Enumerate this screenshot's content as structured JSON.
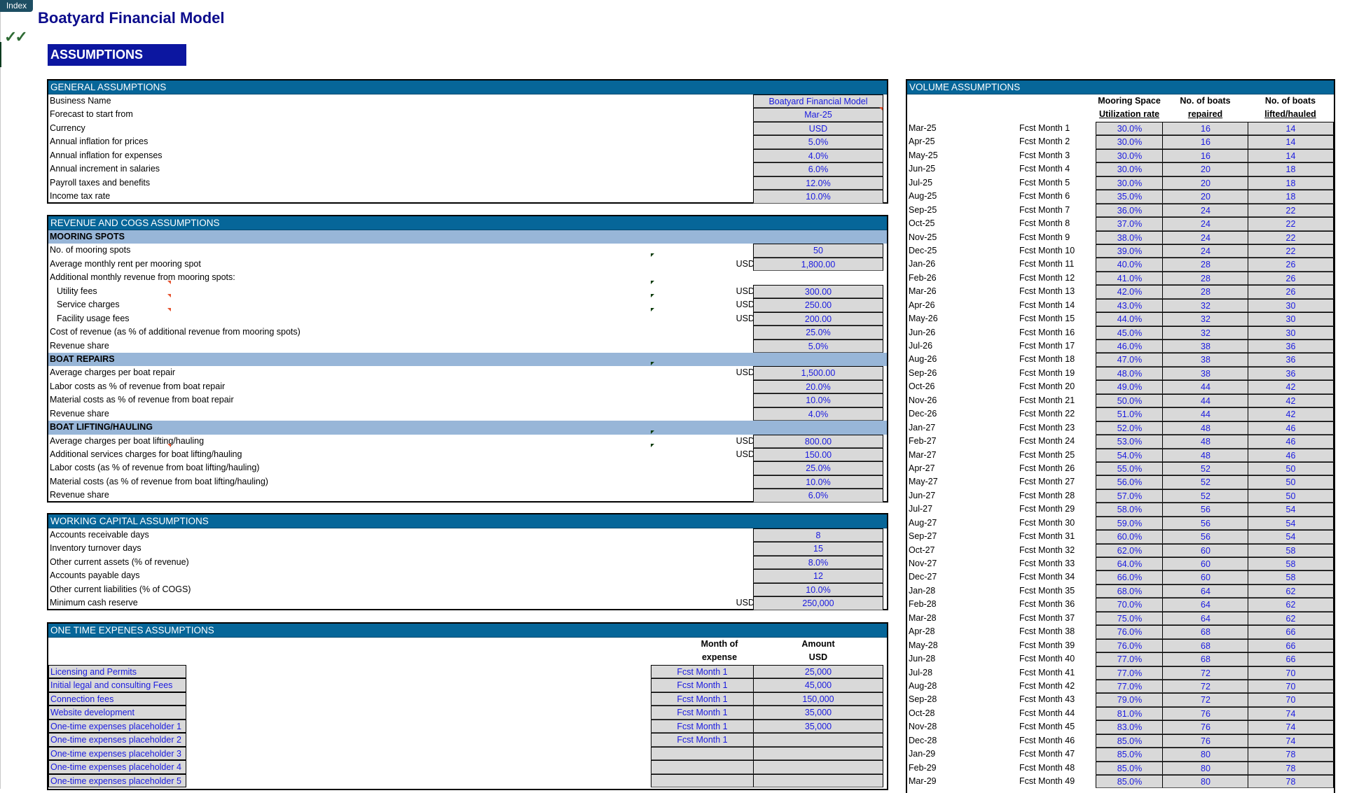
{
  "app": {
    "index_button": "Index",
    "title": "Boatyard Financial Model",
    "check_icon": "✓✓",
    "section_banner": "ASSUMPTIONS"
  },
  "colors": {
    "section_header": "#066699",
    "subsection_header": "#98b6d8",
    "input_text": "#1a1adf",
    "input_fill": "#d9d9d9",
    "title": "#0c0c8c",
    "banner": "#0c16a0"
  },
  "general": {
    "title": "GENERAL ASSUMPTIONS",
    "rows": [
      {
        "label": "Business Name",
        "value": "Boatyard Financial Model"
      },
      {
        "label": "Forecast to start from",
        "value": "Mar-25"
      },
      {
        "label": "Currency",
        "value": "USD"
      },
      {
        "label": "Annual inflation for prices",
        "value": "5.0%"
      },
      {
        "label": "Annual inflation for expenses",
        "value": "4.0%"
      },
      {
        "label": "Annual increment in salaries",
        "value": "6.0%"
      },
      {
        "label": "Payroll taxes and benefits",
        "value": "12.0%"
      },
      {
        "label": "Income tax rate",
        "value": "10.0%"
      }
    ]
  },
  "revenue": {
    "title": "REVENUE AND COGS ASSUMPTIONS",
    "mooring": {
      "title": "MOORING SPOTS",
      "rows": [
        {
          "label": "No. of mooring spots",
          "currency": "",
          "value": "50"
        },
        {
          "label": "Average monthly rent per mooring spot",
          "currency": "USD",
          "value": "1,800.00"
        },
        {
          "label": "Additional monthly revenue from mooring spots:",
          "currency": "",
          "value": null
        },
        {
          "label": "Utility fees",
          "currency": "USD",
          "value": "300.00",
          "indent": true
        },
        {
          "label": "Service charges",
          "currency": "USD",
          "value": "250.00",
          "indent": true
        },
        {
          "label": "Facility usage fees",
          "currency": "USD",
          "value": "200.00",
          "indent": true
        },
        {
          "label": "Cost of revenue (as % of additional revenue from mooring spots)",
          "currency": "",
          "value": "25.0%"
        },
        {
          "label": "Revenue share",
          "currency": "",
          "value": "5.0%"
        }
      ]
    },
    "repairs": {
      "title": "BOAT REPAIRS",
      "rows": [
        {
          "label": "Average charges per boat repair",
          "currency": "USD",
          "value": "1,500.00"
        },
        {
          "label": "Labor costs as % of revenue from boat repair",
          "currency": "",
          "value": "20.0%"
        },
        {
          "label": "Material costs as % of revenue from boat repair",
          "currency": "",
          "value": "10.0%"
        },
        {
          "label": "Revenue share",
          "currency": "",
          "value": "4.0%"
        }
      ]
    },
    "lifting": {
      "title": "BOAT LIFTING/HAULING",
      "rows": [
        {
          "label": "Average charges per boat lifting/hauling",
          "currency": "USD",
          "value": "800.00"
        },
        {
          "label": "Additional services charges for boat lifting/hauling",
          "currency": "USD",
          "value": "150.00"
        },
        {
          "label": "Labor costs (as % of revenue from boat lifting/hauling)",
          "currency": "",
          "value": "25.0%"
        },
        {
          "label": "Material costs (as % of revenue from boat lifting/hauling)",
          "currency": "",
          "value": "10.0%"
        },
        {
          "label": "Revenue share",
          "currency": "",
          "value": "6.0%"
        }
      ]
    }
  },
  "working_capital": {
    "title": "WORKING CAPITAL ASSUMPTIONS",
    "rows": [
      {
        "label": "Accounts receivable days",
        "currency": "",
        "value": "8"
      },
      {
        "label": "Inventory turnover days",
        "currency": "",
        "value": "15"
      },
      {
        "label": "Other current assets (% of revenue)",
        "currency": "",
        "value": "8.0%"
      },
      {
        "label": "Accounts payable days",
        "currency": "",
        "value": "12"
      },
      {
        "label": "Other current liabilities (% of COGS)",
        "currency": "",
        "value": "10.0%"
      },
      {
        "label": "Minimum cash reserve",
        "currency": "USD",
        "value": "250,000"
      }
    ]
  },
  "one_time": {
    "title": "ONE TIME EXPENES ASSUMPTIONS",
    "col_month": [
      "Month of",
      "expense"
    ],
    "col_amount": [
      "Amount",
      "USD"
    ],
    "rows": [
      {
        "label": "Licensing and Permits",
        "month": "Fcst Month 1",
        "amount": "25,000"
      },
      {
        "label": "Initial legal and consulting Fees",
        "month": "Fcst Month 1",
        "amount": "45,000"
      },
      {
        "label": "Connection fees",
        "month": "Fcst Month 1",
        "amount": "150,000"
      },
      {
        "label": "Website development",
        "month": "Fcst Month 1",
        "amount": "35,000"
      },
      {
        "label": "One-time expenses placeholder 1",
        "month": "Fcst Month 1",
        "amount": "35,000"
      },
      {
        "label": "One-time expenses placeholder 2",
        "month": "Fcst Month 1",
        "amount": ""
      },
      {
        "label": "One-time expenses placeholder 3",
        "month": "",
        "amount": ""
      },
      {
        "label": "One-time expenses placeholder 4",
        "month": "",
        "amount": ""
      },
      {
        "label": "One-time expenses placeholder 5",
        "month": "",
        "amount": ""
      }
    ]
  },
  "volume": {
    "title": "VOLUME ASSUMPTIONS",
    "columns": [
      [
        "Mooring Space",
        "Utilization rate"
      ],
      [
        "No. of boats",
        "repaired"
      ],
      [
        "No. of boats",
        "lifted/hauled"
      ]
    ],
    "rows": [
      [
        "Mar-25",
        "Fcst Month 1",
        "30.0%",
        "16",
        "14"
      ],
      [
        "Apr-25",
        "Fcst Month 2",
        "30.0%",
        "16",
        "14"
      ],
      [
        "May-25",
        "Fcst Month 3",
        "30.0%",
        "16",
        "14"
      ],
      [
        "Jun-25",
        "Fcst Month 4",
        "30.0%",
        "20",
        "18"
      ],
      [
        "Jul-25",
        "Fcst Month 5",
        "30.0%",
        "20",
        "18"
      ],
      [
        "Aug-25",
        "Fcst Month 6",
        "35.0%",
        "20",
        "18"
      ],
      [
        "Sep-25",
        "Fcst Month 7",
        "36.0%",
        "24",
        "22"
      ],
      [
        "Oct-25",
        "Fcst Month 8",
        "37.0%",
        "24",
        "22"
      ],
      [
        "Nov-25",
        "Fcst Month 9",
        "38.0%",
        "24",
        "22"
      ],
      [
        "Dec-25",
        "Fcst Month 10",
        "39.0%",
        "24",
        "22"
      ],
      [
        "Jan-26",
        "Fcst Month 11",
        "40.0%",
        "28",
        "26"
      ],
      [
        "Feb-26",
        "Fcst Month 12",
        "41.0%",
        "28",
        "26"
      ],
      [
        "Mar-26",
        "Fcst Month 13",
        "42.0%",
        "28",
        "26"
      ],
      [
        "Apr-26",
        "Fcst Month 14",
        "43.0%",
        "32",
        "30"
      ],
      [
        "May-26",
        "Fcst Month 15",
        "44.0%",
        "32",
        "30"
      ],
      [
        "Jun-26",
        "Fcst Month 16",
        "45.0%",
        "32",
        "30"
      ],
      [
        "Jul-26",
        "Fcst Month 17",
        "46.0%",
        "38",
        "36"
      ],
      [
        "Aug-26",
        "Fcst Month 18",
        "47.0%",
        "38",
        "36"
      ],
      [
        "Sep-26",
        "Fcst Month 19",
        "48.0%",
        "38",
        "36"
      ],
      [
        "Oct-26",
        "Fcst Month 20",
        "49.0%",
        "44",
        "42"
      ],
      [
        "Nov-26",
        "Fcst Month 21",
        "50.0%",
        "44",
        "42"
      ],
      [
        "Dec-26",
        "Fcst Month 22",
        "51.0%",
        "44",
        "42"
      ],
      [
        "Jan-27",
        "Fcst Month 23",
        "52.0%",
        "48",
        "46"
      ],
      [
        "Feb-27",
        "Fcst Month 24",
        "53.0%",
        "48",
        "46"
      ],
      [
        "Mar-27",
        "Fcst Month 25",
        "54.0%",
        "48",
        "46"
      ],
      [
        "Apr-27",
        "Fcst Month 26",
        "55.0%",
        "52",
        "50"
      ],
      [
        "May-27",
        "Fcst Month 27",
        "56.0%",
        "52",
        "50"
      ],
      [
        "Jun-27",
        "Fcst Month 28",
        "57.0%",
        "52",
        "50"
      ],
      [
        "Jul-27",
        "Fcst Month 29",
        "58.0%",
        "56",
        "54"
      ],
      [
        "Aug-27",
        "Fcst Month 30",
        "59.0%",
        "56",
        "54"
      ],
      [
        "Sep-27",
        "Fcst Month 31",
        "60.0%",
        "56",
        "54"
      ],
      [
        "Oct-27",
        "Fcst Month 32",
        "62.0%",
        "60",
        "58"
      ],
      [
        "Nov-27",
        "Fcst Month 33",
        "64.0%",
        "60",
        "58"
      ],
      [
        "Dec-27",
        "Fcst Month 34",
        "66.0%",
        "60",
        "58"
      ],
      [
        "Jan-28",
        "Fcst Month 35",
        "68.0%",
        "64",
        "62"
      ],
      [
        "Feb-28",
        "Fcst Month 36",
        "70.0%",
        "64",
        "62"
      ],
      [
        "Mar-28",
        "Fcst Month 37",
        "75.0%",
        "64",
        "62"
      ],
      [
        "Apr-28",
        "Fcst Month 38",
        "76.0%",
        "68",
        "66"
      ],
      [
        "May-28",
        "Fcst Month 39",
        "76.0%",
        "68",
        "66"
      ],
      [
        "Jun-28",
        "Fcst Month 40",
        "77.0%",
        "68",
        "66"
      ],
      [
        "Jul-28",
        "Fcst Month 41",
        "77.0%",
        "72",
        "70"
      ],
      [
        "Aug-28",
        "Fcst Month 42",
        "77.0%",
        "72",
        "70"
      ],
      [
        "Sep-28",
        "Fcst Month 43",
        "79.0%",
        "72",
        "70"
      ],
      [
        "Oct-28",
        "Fcst Month 44",
        "81.0%",
        "76",
        "74"
      ],
      [
        "Nov-28",
        "Fcst Month 45",
        "83.0%",
        "76",
        "74"
      ],
      [
        "Dec-28",
        "Fcst Month 46",
        "85.0%",
        "76",
        "74"
      ],
      [
        "Jan-29",
        "Fcst Month 47",
        "85.0%",
        "80",
        "78"
      ],
      [
        "Feb-29",
        "Fcst Month 48",
        "85.0%",
        "80",
        "78"
      ],
      [
        "Mar-29",
        "Fcst Month 49",
        "85.0%",
        "80",
        "78"
      ]
    ]
  }
}
